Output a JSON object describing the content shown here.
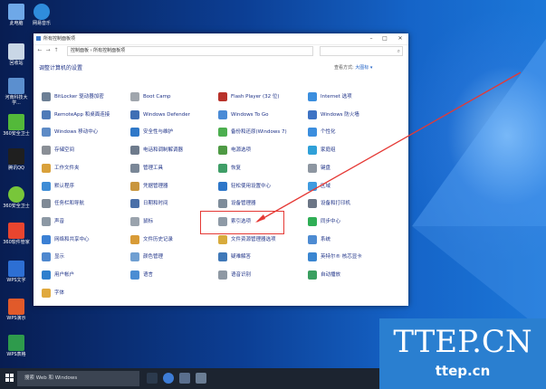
{
  "window": {
    "title": "所有控制面板项",
    "path": "控制面板  ›  所有控制面板项",
    "heading": "调整计算机的设置",
    "view_by_label": "查看方式:",
    "view_by_value": "大图标 ▾"
  },
  "items": [
    "BitLocker 驱动器加密",
    "Boot Camp",
    "Flash Player (32 位)",
    "Internet 选项",
    "RemoteApp 和桌面连接",
    "Windows Defender",
    "Windows To Go",
    "Windows 防火墙",
    "Windows 移动中心",
    "安全性与维护",
    "备份和还原(Windows 7)",
    "个性化",
    "存储空间",
    "电话和调制解调器",
    "电源选项",
    "家庭组",
    "工作文件夹",
    "管理工具",
    "恢复",
    "键盘",
    "默认程序",
    "凭据管理器",
    "轻松使用设置中心",
    "区域",
    "任务栏和导航",
    "日期和时间",
    "设备管理器",
    "设备和打印机",
    "声音",
    "鼠标",
    "索引选项",
    "同步中心",
    "网络和共享中心",
    "文件历史记录",
    "文件资源管理器选项",
    "系统",
    "显示",
    "颜色管理",
    "疑难解答",
    "英特尔® 核芯显卡",
    "用户帐户",
    "语言",
    "语音识别",
    "自动播放",
    "字体"
  ],
  "desktop_icons": [
    "此电脑",
    "网易音乐",
    "回收站",
    "河南科技大学...",
    "360安全卫士",
    "腾讯QQ",
    "360安全卫士",
    "360软件管家",
    "WPS文字",
    "WPS演示",
    "WPS表格"
  ],
  "taskbar": {
    "search": "搜索 Web 和 Windows"
  },
  "watermark": {
    "line1": "TTEP.CN",
    "line2": "ttep.cn"
  },
  "colors": {
    "link": "#1e3287",
    "highlight": "#e53935",
    "accent": "#2263c7"
  }
}
